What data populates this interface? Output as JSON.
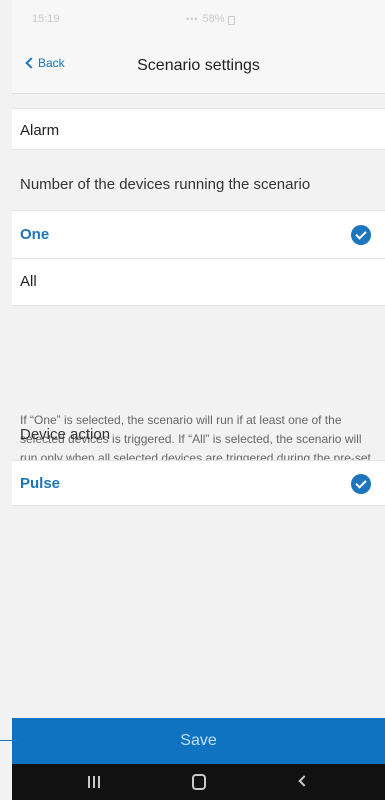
{
  "status_bar": {
    "time": "15:19",
    "signal": "•••",
    "battery": "58%"
  },
  "nav": {
    "back_label": "Back",
    "title": "Scenario settings"
  },
  "alarm": {
    "label": "Alarm"
  },
  "devices_section": {
    "title": "Number of the devices running the scenario",
    "options": [
      {
        "label": "One",
        "selected": true
      },
      {
        "label": "All",
        "selected": false
      }
    ],
    "info": "If “One” is selected, the scenario will run if at least one of the selected devices is triggered. If “All” is selected, the scenario will run only when all selected devices are triggered during the pre-set time."
  },
  "device_action": {
    "title": "Device action",
    "options": [
      {
        "label": "Pulse",
        "selected": true
      }
    ]
  },
  "footer": {
    "save_label": "Save"
  },
  "colors": {
    "accent": "#1d76bb",
    "save_button": "#0f73c2",
    "background": "#f2f2f2",
    "android_nav": "#111111"
  },
  "icons": {
    "back": "chevron-left-icon",
    "selected": "check-circle-icon",
    "recent_apps": "recent-apps-icon",
    "home": "home-icon",
    "system_back": "back-icon"
  }
}
